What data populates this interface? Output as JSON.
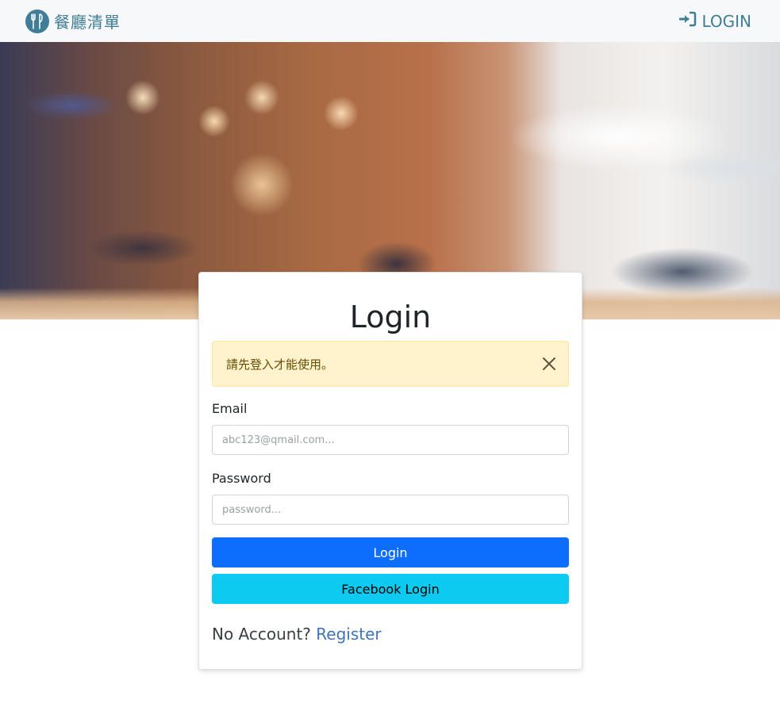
{
  "nav": {
    "brand_text": "餐廳清單",
    "login_label": "LOGIN"
  },
  "colors": {
    "brand": "#3f7e96",
    "navbar_bg": "#f6f8fa",
    "primary": "#0d6efd",
    "info": "#0dcaf0",
    "warning_bg": "#fff3cd",
    "link": "#3f74b8"
  },
  "login_card": {
    "title": "Login",
    "alert_message": "請先登入才能使用。",
    "email_label": "Email",
    "email_placeholder": "abc123@qmail.com...",
    "email_value": "",
    "password_label": "Password",
    "password_placeholder": "password...",
    "password_value": "",
    "login_button": "Login",
    "facebook_button": "Facebook Login",
    "no_account_text": "No Account?",
    "register_link": "Register"
  },
  "icons": {
    "brand_logo": "utensils-icon",
    "nav_login": "sign-in-icon",
    "alert_close": "close-icon"
  }
}
